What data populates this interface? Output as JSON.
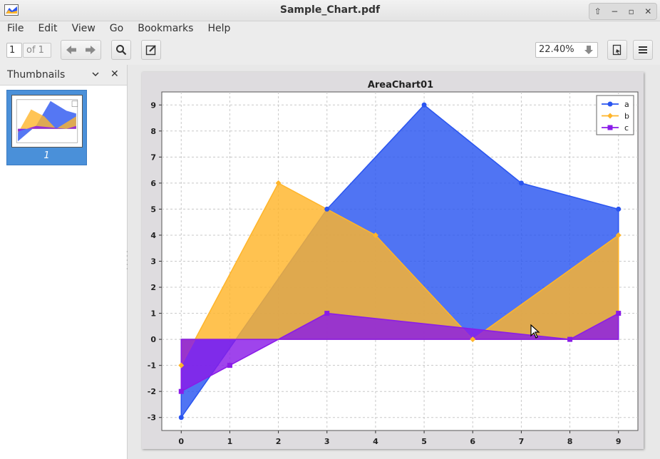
{
  "window": {
    "title": "Sample_Chart.pdf"
  },
  "menu": [
    "File",
    "Edit",
    "View",
    "Go",
    "Bookmarks",
    "Help"
  ],
  "toolbar": {
    "page_number": "1",
    "page_total": "of 1",
    "zoom": "22.40%"
  },
  "sidebar": {
    "title": "Thumbnails",
    "thumbnails": [
      {
        "label": "1"
      }
    ]
  },
  "colors": {
    "a": "#2a55f0",
    "b": "#ffb52a",
    "c": "#8a1be8"
  },
  "chart_data": {
    "type": "area",
    "title": "AreaChart01",
    "x": [
      0,
      1,
      2,
      3,
      4,
      5,
      6,
      7,
      8,
      9
    ],
    "series": [
      {
        "name": "a",
        "marker": "circle",
        "values": [
          -3,
          null,
          null,
          5,
          null,
          9,
          null,
          6,
          null,
          5
        ]
      },
      {
        "name": "b",
        "marker": "diamond",
        "values": [
          -1,
          null,
          6,
          null,
          4,
          null,
          0,
          null,
          null,
          4
        ]
      },
      {
        "name": "c",
        "marker": "square",
        "values": [
          -2,
          -1,
          null,
          1,
          null,
          null,
          null,
          null,
          0,
          1
        ]
      }
    ],
    "xticks": [
      0,
      1,
      2,
      3,
      4,
      5,
      6,
      7,
      8,
      9
    ],
    "yticks": [
      -3,
      -2,
      -1,
      0,
      1,
      2,
      3,
      4,
      5,
      6,
      7,
      8,
      9
    ],
    "xlim": [
      -0.4,
      9.4
    ],
    "ylim": [
      -3.5,
      9.5
    ],
    "grid": true,
    "legend": "top-right"
  }
}
